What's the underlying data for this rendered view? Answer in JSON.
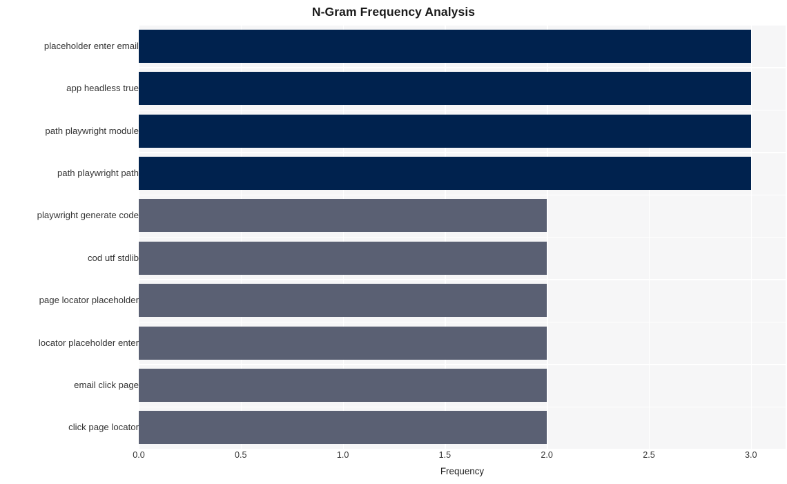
{
  "chart_data": {
    "type": "bar",
    "orientation": "horizontal",
    "title": "N-Gram Frequency Analysis",
    "xlabel": "Frequency",
    "ylabel": "",
    "categories": [
      "placeholder enter email",
      "app headless true",
      "path playwright module",
      "path playwright path",
      "playwright generate code",
      "cod utf stdlib",
      "page locator placeholder",
      "locator placeholder enter",
      "email click page",
      "click page locator"
    ],
    "values": [
      3,
      3,
      3,
      3,
      2,
      2,
      2,
      2,
      2,
      2
    ],
    "bar_colors": [
      "#00224e",
      "#00224e",
      "#00224e",
      "#00224e",
      "#5a6073",
      "#5a6073",
      "#5a6073",
      "#5a6073",
      "#5a6073",
      "#5a6073"
    ],
    "xlim": [
      0,
      3.17
    ],
    "xticks": [
      0.0,
      0.5,
      1.0,
      1.5,
      2.0,
      2.5,
      3.0
    ],
    "xtick_labels": [
      "0.0",
      "0.5",
      "1.0",
      "1.5",
      "2.0",
      "2.5",
      "3.0"
    ],
    "grid": true,
    "grid_color": "#ffffff",
    "plot_background": "#f6f6f7",
    "figure_background": "#ffffff",
    "legend": null,
    "colors": {
      "high_frequency": "#00224e",
      "low_frequency": "#5a6073",
      "text": "#333333",
      "title": "#1a1a1a"
    }
  }
}
